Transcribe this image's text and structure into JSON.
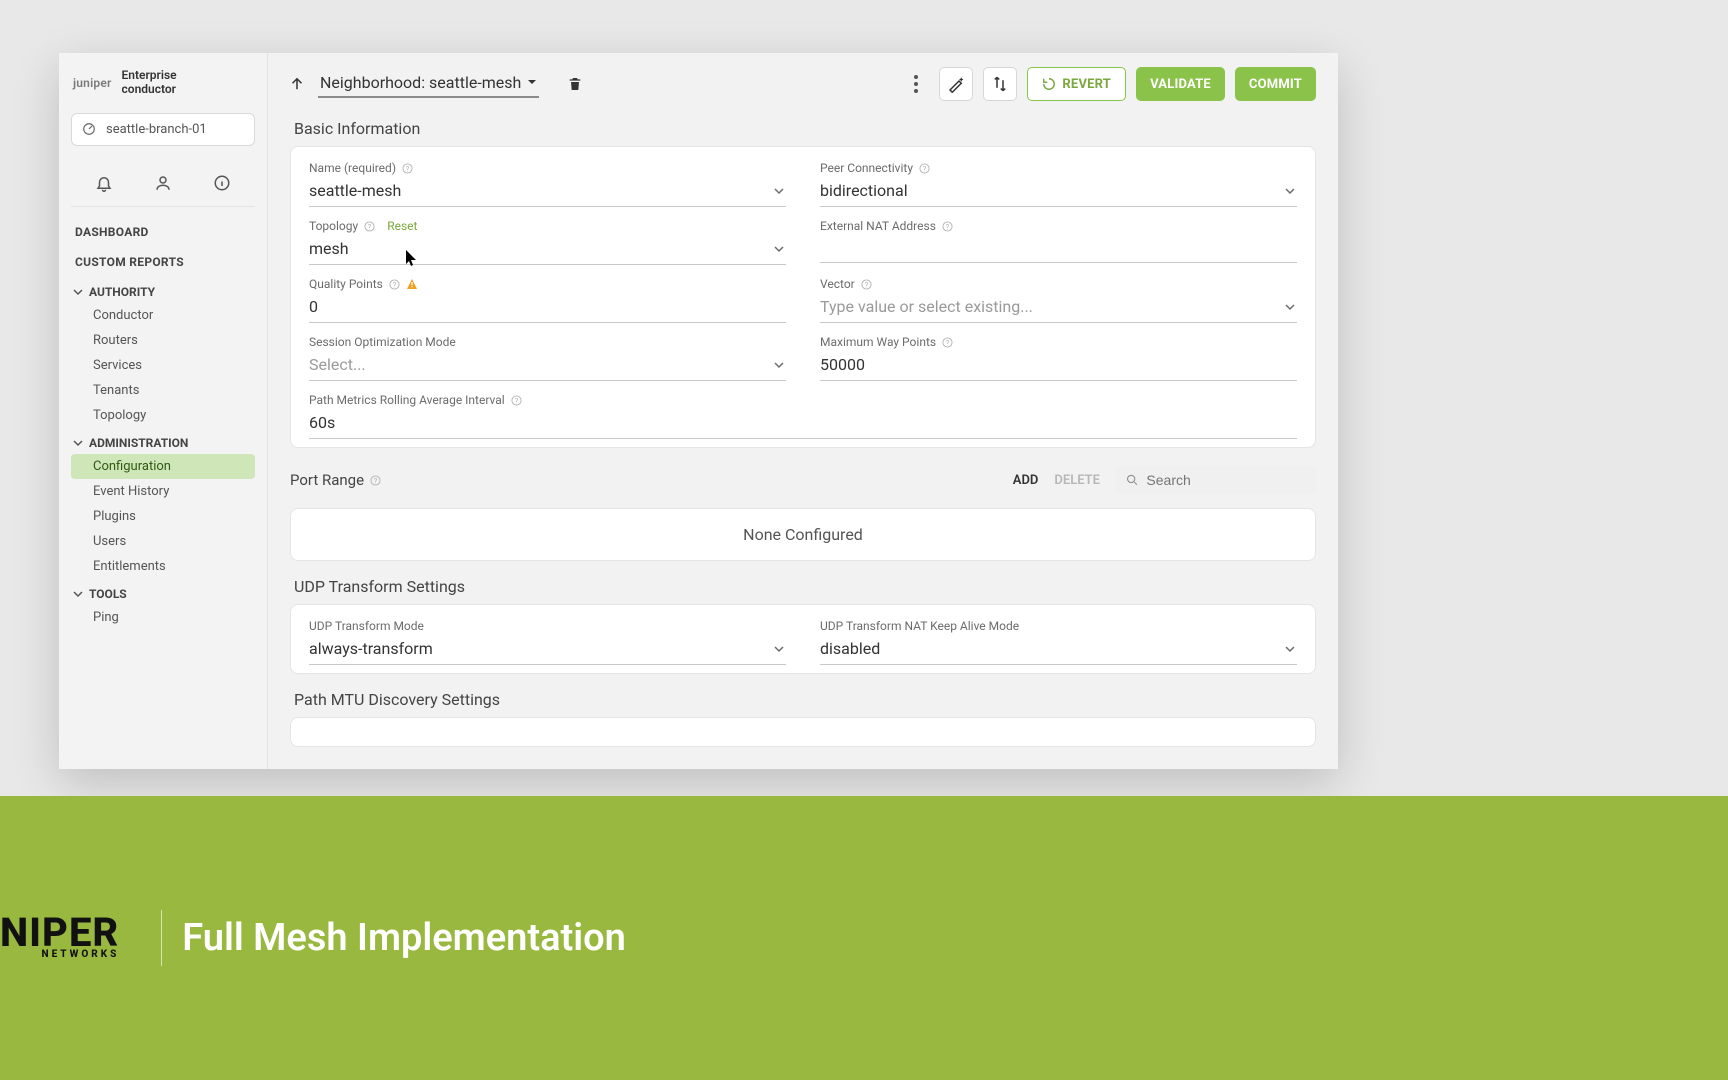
{
  "brand": {
    "logo_text": "juniper",
    "name_line1": "Enterprise",
    "name_line2": "conductor"
  },
  "router_badge": "seattle-branch-01",
  "nav": {
    "dashboard": "DASHBOARD",
    "custom_reports": "CUSTOM REPORTS",
    "authority": {
      "title": "AUTHORITY",
      "items": [
        "Conductor",
        "Routers",
        "Services",
        "Tenants",
        "Topology"
      ]
    },
    "administration": {
      "title": "ADMINISTRATION",
      "items": [
        "Configuration",
        "Event History",
        "Plugins",
        "Users",
        "Entitlements"
      ],
      "active_index": 0
    },
    "tools": {
      "title": "TOOLS",
      "items": [
        "Ping"
      ]
    }
  },
  "topbar": {
    "breadcrumb": "Neighborhood: seattle-mesh",
    "revert": "REVERT",
    "validate": "VALIDATE",
    "commit": "COMMIT"
  },
  "sections": {
    "basic": {
      "title": "Basic Information",
      "name_label": "Name (required)",
      "name_value": "seattle-mesh",
      "peer_label": "Peer Connectivity",
      "peer_value": "bidirectional",
      "topology_label": "Topology",
      "topology_reset": "Reset",
      "topology_value": "mesh",
      "ext_nat_label": "External NAT Address",
      "ext_nat_value": "",
      "quality_label": "Quality Points",
      "quality_value": "0",
      "vector_label": "Vector",
      "vector_placeholder": "Type value or select existing...",
      "som_label": "Session Optimization Mode",
      "som_placeholder": "Select...",
      "maxway_label": "Maximum Way Points",
      "maxway_value": "50000",
      "pmr_label": "Path Metrics Rolling Average Interval",
      "pmr_value": "60s"
    },
    "port_range": {
      "title": "Port Range",
      "add": "ADD",
      "delete": "DELETE",
      "search_placeholder": "Search",
      "empty": "None Configured"
    },
    "udp": {
      "title": "UDP Transform Settings",
      "mode_label": "UDP Transform Mode",
      "mode_value": "always-transform",
      "nat_label": "UDP Transform NAT Keep Alive Mode",
      "nat_value": "disabled"
    },
    "pmtu": {
      "title": "Path MTU Discovery Settings"
    }
  },
  "banner": {
    "brand_top": "NIPER",
    "brand_bottom": "NETWORKS",
    "title": "Full Mesh Implementation"
  }
}
